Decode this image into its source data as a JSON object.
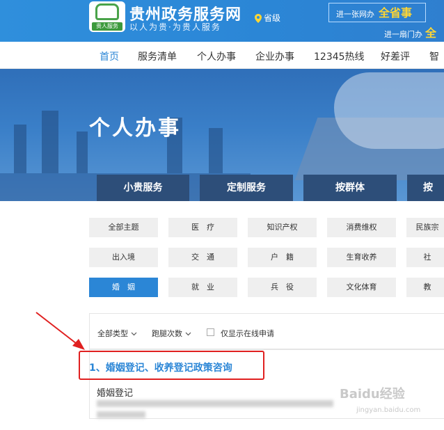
{
  "header": {
    "logo_tag": "贵人服务",
    "title": "贵州政务服务网",
    "slogan": "以人为贵·为贵人服务",
    "region": "省级",
    "promo1_prefix": "进一张网办",
    "promo1_emph": "全省事",
    "promo2_prefix": "进一扇门办",
    "promo2_emph": "全"
  },
  "nav": {
    "items": [
      "首页",
      "服务清单",
      "个人办事",
      "企业办事",
      "12345热线",
      "好差评",
      "智"
    ]
  },
  "banner": {
    "title": "个人办事",
    "tabs": [
      "小贵服务",
      "定制服务",
      "按群体",
      "按"
    ]
  },
  "topics": {
    "row1": [
      "全部主题",
      "医　疗",
      "知识产权",
      "消费维权",
      "民族宗"
    ],
    "row2": [
      "出入境",
      "交　通",
      "户　籍",
      "生育收养",
      "社"
    ],
    "row3": [
      "婚　姻",
      "就　业",
      "兵　役",
      "文化体育",
      "教"
    ]
  },
  "filters": {
    "all_types": "全部类型",
    "visits": "跑腿次数",
    "online_only": "仅显示在线申请"
  },
  "results": {
    "first_title": "1、婚姻登记、收养登记政策咨询",
    "sub_item": "婚姻登记"
  },
  "watermark": {
    "main": "Baidu经验",
    "sub": "jingyan.baidu.com"
  },
  "colors": {
    "primary": "#2b86d6",
    "header_bg": "#2f8fdc",
    "tab_bg": "#2d4e79",
    "highlight": "#e02020",
    "accent": "#ffd633"
  }
}
